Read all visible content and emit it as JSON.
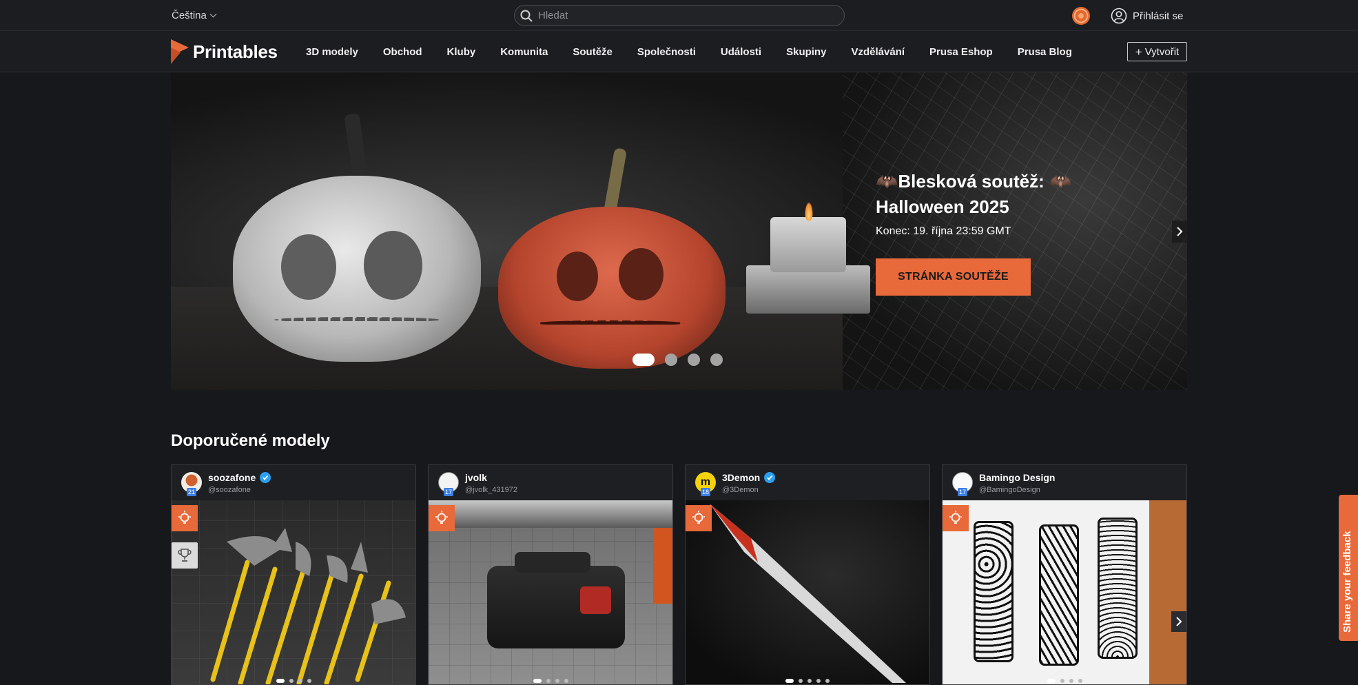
{
  "topbar": {
    "language": "Čeština",
    "search_placeholder": "Hledat",
    "login": "Přihlásit se"
  },
  "navbar": {
    "logo": "Printables",
    "items": [
      "3D modely",
      "Obchod",
      "Kluby",
      "Komunita",
      "Soutěže",
      "Společnosti",
      "Události",
      "Skupiny",
      "Vzdělávání",
      "Prusa Eshop",
      "Prusa Blog"
    ],
    "create": "Vytvořit"
  },
  "hero": {
    "title_line1": "🦇Blesková soutěž: 🦇",
    "title_line2": "Halloween 2025",
    "subtitle": "Konec: 19. října 23:59 GMT",
    "button": "STRÁNKA SOUTĚŽE",
    "slide_count": 4,
    "active_slide": 1
  },
  "section": {
    "title": "Doporučené modely"
  },
  "cards": [
    {
      "name": "soozafone",
      "handle": "@soozafone",
      "level": "21",
      "verified": true,
      "trophy": true
    },
    {
      "name": "jvolk",
      "handle": "@jvolk_431972",
      "level": "17",
      "verified": false,
      "trophy": false
    },
    {
      "name": "3Demon",
      "handle": "@3Demon",
      "level": "18",
      "verified": true,
      "trophy": false
    },
    {
      "name": "Bamingo Design",
      "handle": "@BamingoDesign",
      "level": "17",
      "verified": false,
      "trophy": false
    }
  ],
  "feedback": "Share your feedback",
  "colors": {
    "accent": "#e8693a",
    "background": "#17181b",
    "verified": "#2aa0f0"
  }
}
